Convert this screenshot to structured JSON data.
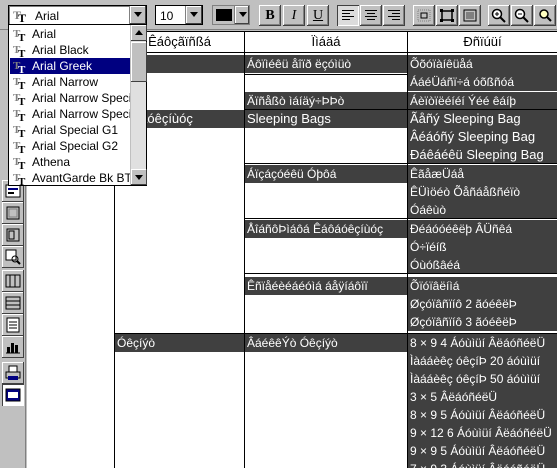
{
  "toolbar": {
    "font_value": "Arial",
    "size_value": "10",
    "text_color": "#000000",
    "bold_label": "B",
    "italic_label": "I",
    "underline_label": "U",
    "icons": [
      "align-left-icon",
      "align-center-icon",
      "align-right-icon",
      "grid-icon",
      "frame-icon",
      "fit-icon",
      "zoom-in-icon",
      "zoom-out-icon",
      "find-icon"
    ]
  },
  "font_dropdown": {
    "items": [
      {
        "label": "Arial",
        "selected": false
      },
      {
        "label": "Arial Black",
        "selected": false
      },
      {
        "label": "Arial Greek",
        "selected": true
      },
      {
        "label": "Arial Narrow",
        "selected": false
      },
      {
        "label": "Arial Narrow Special",
        "selected": false
      },
      {
        "label": "Arial Narrow Special",
        "selected": false
      },
      {
        "label": "Arial Special G1",
        "selected": false
      },
      {
        "label": "Arial Special G2",
        "selected": false
      },
      {
        "label": "Athena",
        "selected": false
      },
      {
        "label": "AvantGarde Bk BT",
        "selected": false
      }
    ]
  },
  "report": {
    "headers": [
      "Êáôçãïñßá",
      "Ïìáäá",
      "Ðñïúüí"
    ],
    "category_col": [
      {
        "text": "ïñßá"
      },
      {
        "text": "Êáôáóêçíùóç"
      },
      {
        "text": "Óêçíýò"
      }
    ],
    "group_col": [
      {
        "text": "Áôïìéêü åîïð ëçóìüò"
      },
      {
        "text": "Äïñåßò ìáíäý÷ÞÞò"
      },
      {
        "text": "Sleeping Bags"
      },
      {
        "text": "Áïçáçóéêü Óþôá"
      },
      {
        "text": "ÅîáñôÞìáôá Êáôáóêçíùóç"
      },
      {
        "text": "Êñïåéèéáéóìá áåÿíáôïï"
      },
      {
        "text": "ÂáéêêÝò Óêçíýò"
      }
    ],
    "product_col": [
      "Õõóïàíêüåá",
      "ÁáéÜáñï÷á óõßñóá",
      "Áèïòïëéíéí Ýéé êáíþ",
      "Ãåñý Sleeping Bag",
      "Âéáóñý Sleeping Bag",
      "Ðáêáéêü Sleeping Bag",
      "ÊãåæÜáå",
      "ÊÜìöéò Õåñáåßñéïò",
      "Óáêùò",
      "Ðéáóóéêëþ ÂÜñêá",
      "Ó÷ïéíß",
      "Óùóßâéá",
      "Õïóïâëíìá",
      "Øçóïâñïíô 2 ãóéêëÞ",
      "Øçóïâñïíô 3 ãóéêëÞ",
      "8 × 9 4 Áóùìüí ÂëáóñéëÜ",
      "Ìàááèêç óêçíÞ 20 áóùìüí",
      "Ìàááèêç óêçíÞ 50 áóùìüí",
      "3 × 5 ÂëáóñéëÜ",
      "8 × 9 5 Áóùìüí ÂëáóñéëÜ",
      "9 × 12 6 Áóùìüí ÂëáóñéëÜ",
      "9 × 9 5 Áóùìüí ÂëáóñéëÜ",
      "7 × 9 3 Áóùìüí ÂëáóñéëÜ"
    ]
  }
}
